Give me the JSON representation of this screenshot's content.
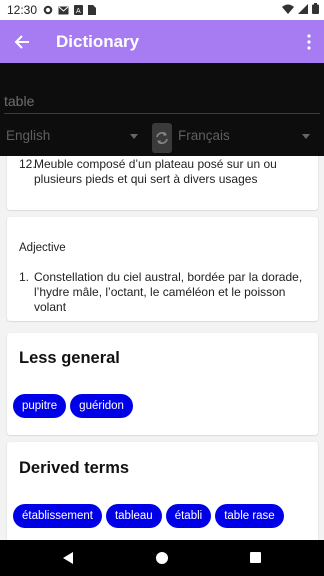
{
  "status_bar": {
    "time": "12:30"
  },
  "app_bar": {
    "title": "Dictionary"
  },
  "search": {
    "value": "",
    "placeholder": "table"
  },
  "languages": {
    "from": "English",
    "to": "Français"
  },
  "definitions_card": {
    "items": [
      {
        "number": "12.",
        "text": "Meuble composé d’un plateau posé sur un ou plusieurs pieds et qui sert à divers usages"
      }
    ]
  },
  "adjective_card": {
    "part_of_speech": "Adjective",
    "items": [
      {
        "number": "1.",
        "text": "Constellation du ciel austral, bordée par la dorade, l’hydre mâle, l’octant, le caméléon et le poisson volant"
      }
    ]
  },
  "less_general": {
    "title": "Less general",
    "chips": [
      "pupitre",
      "guéridon"
    ]
  },
  "derived_terms": {
    "title": "Derived terms",
    "chips": [
      "établissement",
      "tableau",
      "établi",
      "table rase"
    ]
  },
  "colors": {
    "app_bar": "#a77cf2",
    "chip": "#0000e8",
    "search_background": "#0d0d0d"
  }
}
